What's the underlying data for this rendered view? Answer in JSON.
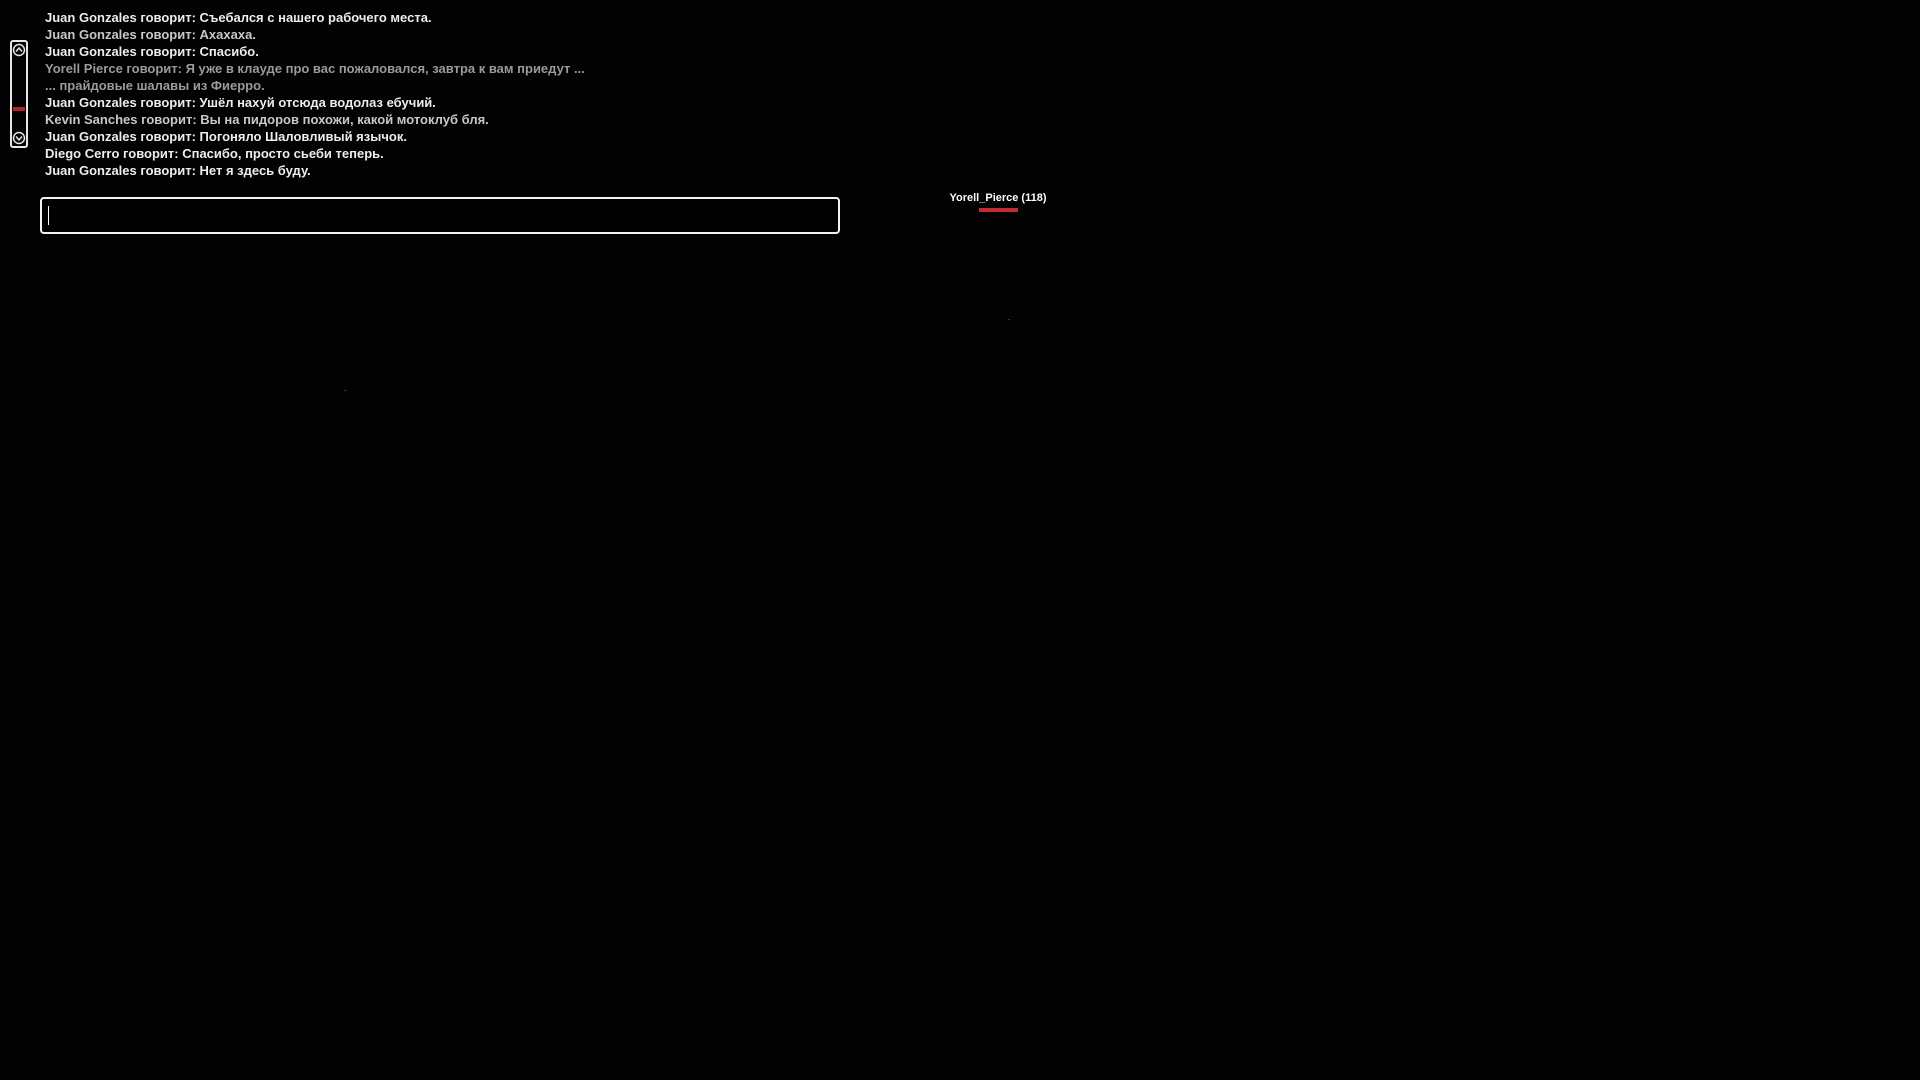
{
  "chat": {
    "lines": [
      {
        "text": "Juan Gonzales говорит: Съебался с нашего рабочего места."
      },
      {
        "text": "Juan Gonzales говорит: Ахахаха."
      },
      {
        "text": "Juan Gonzales говорит: Спасибо."
      },
      {
        "text": "Yorell Pierce говорит: Я уже в клауде про вас пожаловался, завтра к вам приедут ..."
      },
      {
        "text": "... прайдовые шалавы из Фиерро."
      },
      {
        "text": "Juan Gonzales говорит: Ушёл нахуй отсюда водолаз ебучий."
      },
      {
        "text": "Kevin Sanches говорит: Вы на пидоров похожи, какой мотоклуб бля."
      },
      {
        "text": "Juan Gonzales говорит: Погоняло Шаловливый язычок."
      },
      {
        "text": "Diego Cerro говорит: Спасибо, просто сьеби теперь."
      },
      {
        "text": "Juan Gonzales говорит: Нет я здесь буду."
      }
    ],
    "input_value": "",
    "scroll_position": 0.62
  },
  "player": {
    "nametag": "Yorell_Pierce (118)",
    "health": 1.0
  },
  "colors": {
    "health": "#c42a32",
    "scroll_thumb": "#b3202a",
    "text_bright": "#ededed",
    "text_dim": "#9b9b9b"
  },
  "icons": {
    "scroll_up": "chevron-up-icon",
    "scroll_down": "chevron-down-icon"
  }
}
